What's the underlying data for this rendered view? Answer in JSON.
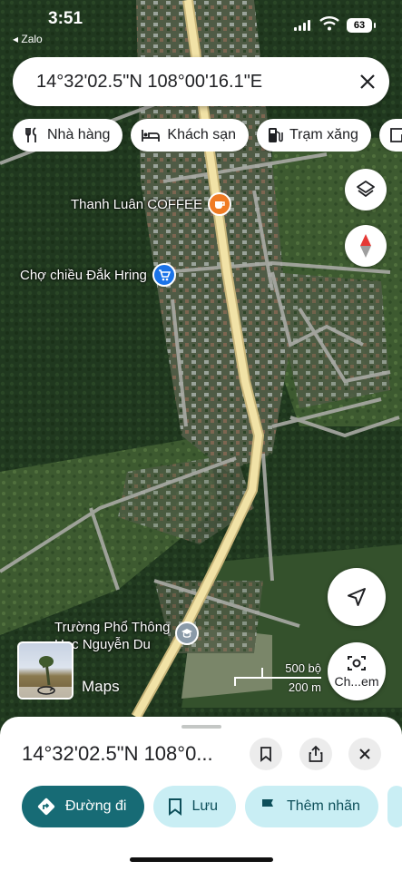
{
  "status": {
    "time": "3:51",
    "back_app": "◂ Zalo",
    "battery": "63"
  },
  "search": {
    "value": "14°32'02.5\"N 108°00'16.1\"E",
    "close_icon": "close-icon"
  },
  "chips": [
    {
      "label": "Nhà hàng",
      "icon": "restaurant-icon"
    },
    {
      "label": "Khách sạn",
      "icon": "hotel-icon"
    },
    {
      "label": "Trạm xăng",
      "icon": "gas-station-icon"
    },
    {
      "label": "",
      "icon": "store-icon"
    }
  ],
  "map": {
    "pois": [
      {
        "name": "Thanh Luân COFFEE",
        "icon": "coffee-icon",
        "color": "#f07b24"
      },
      {
        "name": "Chợ chiều Đắk Hring",
        "icon": "shopping-cart-icon",
        "color": "#1a73e8"
      },
      {
        "name": "Trường Phổ Thông\nHọc Nguyễn Du",
        "icon": "school-icon",
        "color": "#8a9aa8"
      }
    ],
    "maps_logo": "Maps",
    "scale_top": "500 bộ",
    "scale_bottom": "200 m",
    "lens_label": "Ch...em"
  },
  "sheet": {
    "title": "14°32'02.5\"N 108°0...",
    "actions": [
      {
        "label": "Đường đi",
        "icon": "directions-icon",
        "style": "primary"
      },
      {
        "label": "Lưu",
        "icon": "bookmark-icon",
        "style": "secondary"
      },
      {
        "label": "Thêm nhãn",
        "icon": "flag-icon",
        "style": "secondary"
      }
    ]
  },
  "colors": {
    "primary": "#176b75",
    "secondary": "#c9eef4",
    "road": "#f1e2a6"
  }
}
